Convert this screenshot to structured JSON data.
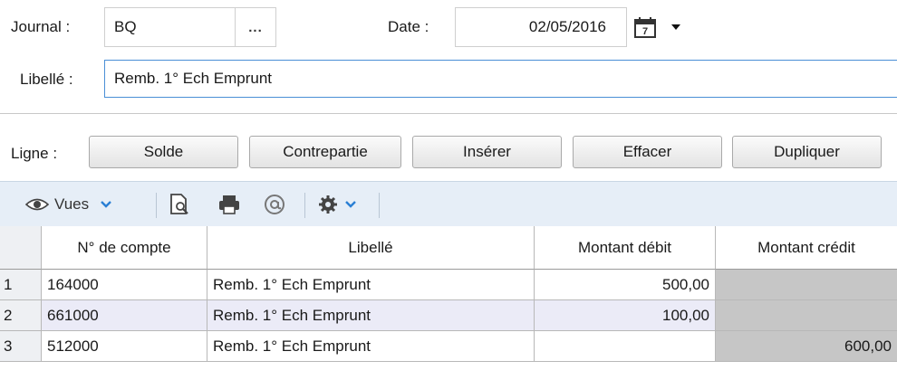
{
  "form": {
    "journal_label": "Journal :",
    "journal_value": "BQ",
    "journal_more": "...",
    "date_label": "Date :",
    "date_value": "02/05/2016",
    "calendar_day": "7",
    "libelle_label": "Libellé :",
    "libelle_value": "Remb. 1° Ech Emprunt"
  },
  "ligne": {
    "label": "Ligne :",
    "buttons": {
      "solde": "Solde",
      "contrepartie": "Contrepartie",
      "inserer": "Insérer",
      "effacer": "Effacer",
      "dupliquer": "Dupliquer"
    }
  },
  "toolbar": {
    "vues_label": "Vues"
  },
  "table": {
    "headers": [
      "N° de compte",
      "Libellé",
      "Montant débit",
      "Montant crédit"
    ],
    "rows": [
      {
        "n": "1",
        "compte": "164000",
        "libelle": "Remb. 1° Ech Emprunt",
        "debit": "500,00",
        "credit": ""
      },
      {
        "n": "2",
        "compte": "661000",
        "libelle": "Remb. 1° Ech Emprunt",
        "debit": "100,00",
        "credit": ""
      },
      {
        "n": "3",
        "compte": "512000",
        "libelle": "Remb. 1° Ech Emprunt",
        "debit": "",
        "credit": "600,00"
      }
    ]
  },
  "colors": {
    "accent": "#4a8fd6",
    "toolbar_bg": "#e6eef7",
    "row_alt": "#ebebf7",
    "disabled_cell": "#c6c6c6"
  }
}
